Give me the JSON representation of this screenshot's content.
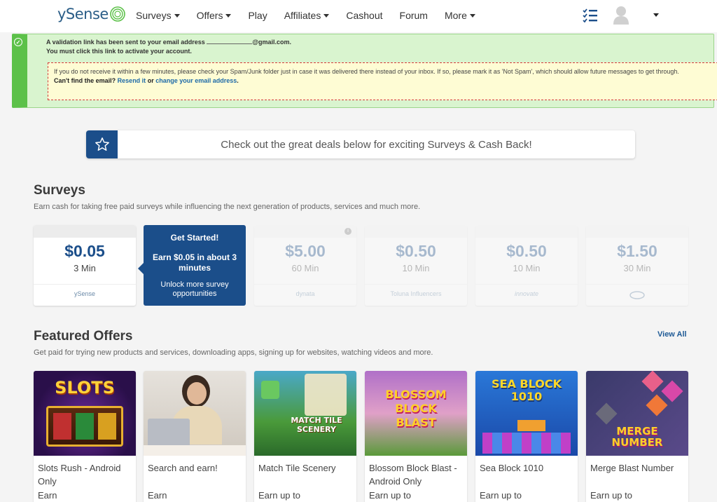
{
  "header": {
    "logo_text": "ySense",
    "nav": [
      {
        "label": "Surveys",
        "dropdown": true
      },
      {
        "label": "Offers",
        "dropdown": true
      },
      {
        "label": "Play",
        "dropdown": false
      },
      {
        "label": "Affiliates",
        "dropdown": true
      },
      {
        "label": "Cashout",
        "dropdown": false
      },
      {
        "label": "Forum",
        "dropdown": false
      },
      {
        "label": "More",
        "dropdown": true
      }
    ],
    "icons": [
      "checklist-icon",
      "user-avatar-icon",
      "chevron-down-icon"
    ]
  },
  "banner": {
    "line1_prefix": "A validation link has been sent to your email address",
    "line1_suffix": "@gmail.com.",
    "line2": "You must click this link to activate your account.",
    "warning": "If you do not receive it within a few minutes, please check your Spam/Junk folder just in case it was delivered there instead of your inbox. If so, please mark it as 'Not Spam', which should allow future messages to get through.",
    "cant_find": "Can't find the email?",
    "resend": "Resend it",
    "or": "or",
    "change": "change your email address",
    "period": "."
  },
  "deals": {
    "text": "Check out the great deals below for exciting Surveys & Cash Back!"
  },
  "surveys": {
    "title": "Surveys",
    "subtitle": "Earn cash for taking free paid surveys while influencing the next generation of products, services and much more.",
    "cards": [
      {
        "price": "$0.05",
        "time": "3 Min",
        "provider": "ySense",
        "faded": false
      },
      {
        "price": "$5.00",
        "time": "60 Min",
        "provider": "dynata",
        "faded": true
      },
      {
        "price": "$0.50",
        "time": "10 Min",
        "provider": "Toluna Influencers",
        "faded": true
      },
      {
        "price": "$0.50",
        "time": "10 Min",
        "provider": "innovate",
        "faded": true
      },
      {
        "price": "$1.50",
        "time": "30 Min",
        "provider": "",
        "faded": true
      }
    ],
    "get_started": {
      "title": "Get Started!",
      "earn": "Earn $0.05 in about 3 minutes",
      "unlock": "Unlock more survey opportunities"
    }
  },
  "offers": {
    "title": "Featured Offers",
    "subtitle": "Get paid for trying new products and services, downloading apps, signing up for websites, watching videos and more.",
    "view_all": "View All",
    "cards": [
      {
        "name": "Slots Rush - Android Only",
        "earn": "Earn",
        "img_text": "SLOTS"
      },
      {
        "name": "Search and earn!",
        "earn": "Earn",
        "img_text": ""
      },
      {
        "name": "Match Tile Scenery",
        "earn": "Earn up to",
        "img_text": "MATCH TILE SCENERY"
      },
      {
        "name": "Blossom Block Blast - Android Only",
        "earn": "Earn up to",
        "img_text": "BLOSSOM BLOCK BLAST"
      },
      {
        "name": "Sea Block 1010",
        "earn": "Earn up to",
        "img_text": "SEA BLOCK 1010"
      },
      {
        "name": "Merge Blast Number",
        "earn": "Earn up to",
        "img_text": "MERGE NUMBER"
      }
    ]
  },
  "colors": {
    "brand": "#1b4e8a",
    "banner_green": "#5cc149",
    "banner_bg": "#d9f4cf",
    "warn_bg": "#fefcd4",
    "warn_border": "#d43b3b"
  }
}
